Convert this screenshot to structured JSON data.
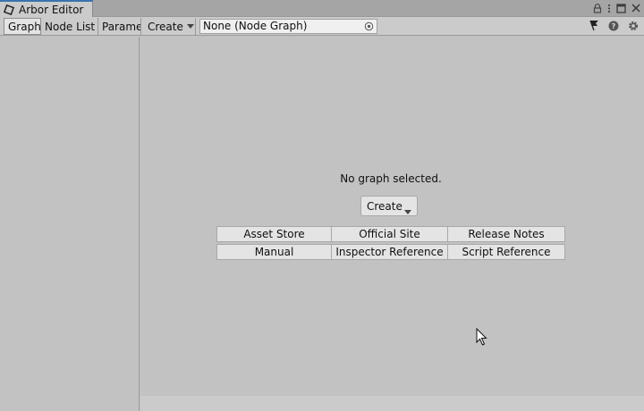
{
  "window": {
    "tab_title": "Arbor Editor"
  },
  "toolbar": {
    "tabs": [
      {
        "label": "Graph",
        "active": true
      },
      {
        "label": "Node List",
        "active": false
      },
      {
        "label": "Parame",
        "active": false
      }
    ],
    "create_label": "Create",
    "graph_field_value": "None (Node Graph)"
  },
  "main": {
    "empty_message": "No graph selected.",
    "create_button_label": "Create",
    "links_row1": [
      "Asset Store",
      "Official Site",
      "Release Notes"
    ],
    "links_row2": [
      "Manual",
      "Inspector Reference",
      "Script Reference"
    ]
  },
  "icons": {
    "app": "arbor-icon",
    "lock": "lock-icon",
    "menu": "kebab-menu-icon",
    "maximize": "maximize-icon",
    "close": "close-icon",
    "picker": "object-picker-icon",
    "flag": "flag-icon",
    "help": "help-icon",
    "settings": "gear-icon",
    "cursor": "mouse-cursor-icon"
  },
  "colors": {
    "window_bg": "#c2c2c2",
    "toolbar_bg": "#cbcbcb",
    "button_bg": "#e4e4e4",
    "tab_accent": "#3a72b0"
  }
}
